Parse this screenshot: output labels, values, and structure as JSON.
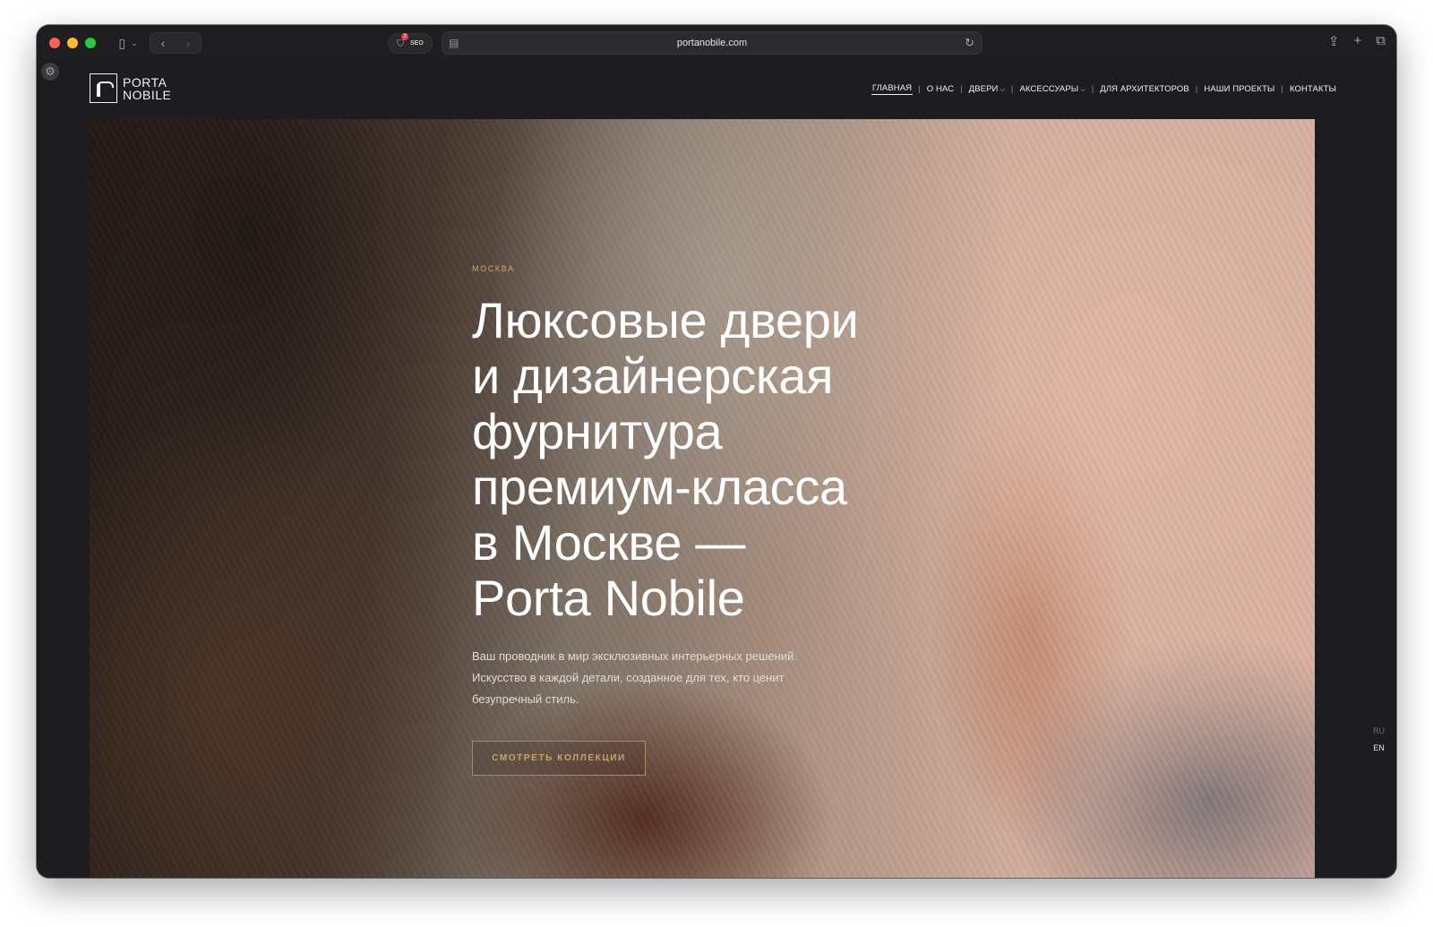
{
  "browser": {
    "url": "portanobile.com",
    "extension_label": "SEO",
    "extension_badge": "2"
  },
  "site": {
    "logo": {
      "line1": "PORTA",
      "line2": "NOBILE"
    },
    "nav": [
      {
        "label": "ГЛАВНАЯ",
        "active": true,
        "dropdown": false
      },
      {
        "label": "О НАС",
        "active": false,
        "dropdown": false
      },
      {
        "label": "ДВЕРИ",
        "active": false,
        "dropdown": true
      },
      {
        "label": "АКСЕССУАРЫ",
        "active": false,
        "dropdown": true
      },
      {
        "label": "ДЛЯ АРХИТЕКТОРОВ",
        "active": false,
        "dropdown": false
      },
      {
        "label": "НАШИ ПРОЕКТЫ",
        "active": false,
        "dropdown": false
      },
      {
        "label": "КОНТАКТЫ",
        "active": false,
        "dropdown": false
      }
    ],
    "separator": "|"
  },
  "hero": {
    "eyebrow": "МОСКВА",
    "title": "Люксовые двери\nи дизайнерская\nфурнитура\nпремиум-класса\nв Москве —\nPorta Nobile",
    "description": "Ваш проводник в мир эксклюзивных интерьерных решений.\nИскусство в каждой детали, созданное для тех, кто ценит\nбезупречный стиль.",
    "cta_label": "СМОТРЕТЬ КОЛЛЕКЦИИ"
  },
  "language": {
    "options": [
      "RU",
      "EN"
    ],
    "selected": "EN"
  },
  "colors": {
    "accent": "#c8a46a",
    "background": "#1d1d1f",
    "text": "#ffffff"
  }
}
